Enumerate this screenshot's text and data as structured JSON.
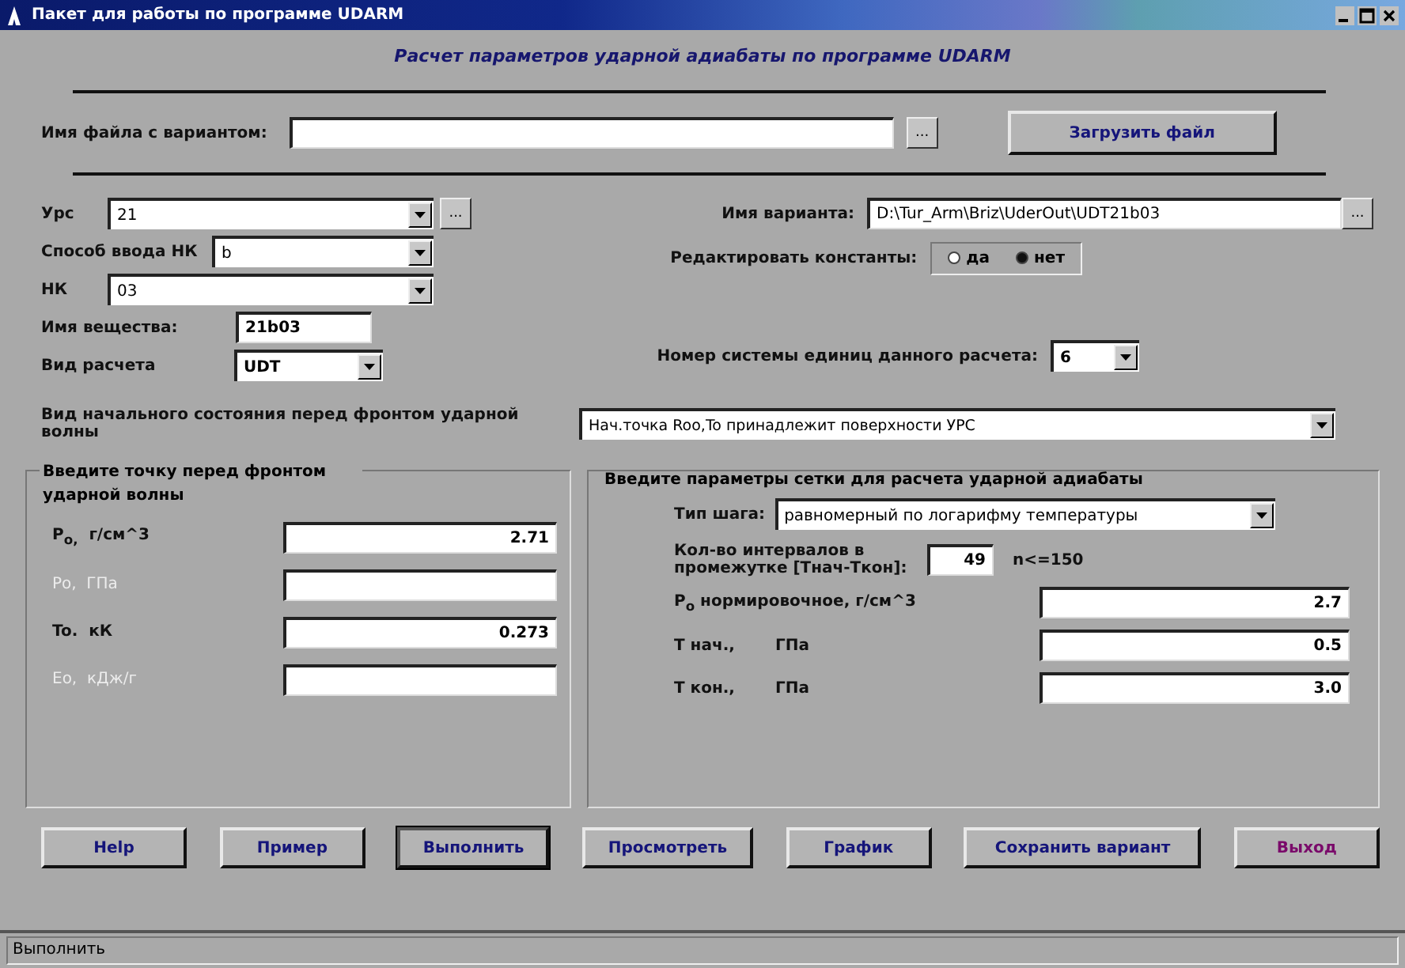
{
  "window": {
    "title": "Пакет для работы по программе UDARM"
  },
  "heading": "Расчет параметров ударной адиабаты по программе UDARM",
  "file_row": {
    "label": "Имя файла с вариантом:",
    "browse": "...",
    "load_button": "Загрузить файл"
  },
  "left_fields": [
    {
      "kind": "combo",
      "label": "Урс",
      "value": "21",
      "browse": "..."
    },
    {
      "kind": "combo",
      "label": "Способ ввода НК",
      "value": "b"
    },
    {
      "kind": "combo",
      "label": "НК",
      "value": "03"
    },
    {
      "kind": "text",
      "label": "Имя вещества:",
      "value": "21b03"
    },
    {
      "kind": "combo",
      "label": "Вид расчета",
      "value": "UDT"
    }
  ],
  "variant": {
    "label": "Имя варианта:",
    "value": "D:\\Tur_Arm\\Briz\\UderOut\\UDT21b03",
    "browse": "..."
  },
  "edit_constants": {
    "label": "Редактировать константы:",
    "options": [
      {
        "label": "да",
        "selected": false
      },
      {
        "label": "нет",
        "selected": true
      }
    ]
  },
  "units": {
    "label": "Номер системы единиц данного расчета:",
    "value": "6"
  },
  "initial_state": {
    "label": "Вид начального состояния перед фронтом ударной волны",
    "value": "Нач.точка Roo,To принадлежит поверхности УРС"
  },
  "point_group": {
    "title": "Введите точку перед фронтом ударной волны",
    "fields": [
      {
        "label": "Р$_{o,}$  г/см^3",
        "value": "2.71",
        "disabled": false
      },
      {
        "label": "Ро,  ГПа",
        "disabled": true
      },
      {
        "label": "To.  кК",
        "value": "0.273",
        "disabled": false
      },
      {
        "label": "Eo,  кДж/г",
        "disabled": true
      }
    ]
  },
  "grid_group": {
    "title": "Введите параметры сетки для расчета ударной адиабаты",
    "step": {
      "label": "Тип шага:",
      "value": "равномерный по логарифму температуры"
    },
    "intervals": {
      "label": "Кол-во интервалов в промежутке [Тнач-Ткон]:",
      "value": "49",
      "hint": "n<=150"
    },
    "fields": [
      {
        "label": "Р$_{o}$ нормировочное, г/см^3",
        "value": "2.7"
      },
      {
        "label": "T нач.,",
        "unit": "ГПа",
        "value": "0.5"
      },
      {
        "label": "T кон.,",
        "unit": "ГПа",
        "value": "3.0"
      }
    ]
  },
  "buttons": [
    {
      "label": "Help",
      "kind": "normal"
    },
    {
      "label": "Пример",
      "kind": "normal"
    },
    {
      "label": "Выполнить",
      "kind": "default"
    },
    {
      "label": "Просмотреть",
      "kind": "normal"
    },
    {
      "label": "График",
      "kind": "normal"
    },
    {
      "label": "Сохранить вариант",
      "kind": "normal"
    },
    {
      "label": "Выход",
      "kind": "exit"
    }
  ],
  "status_bar": "Выполнить"
}
